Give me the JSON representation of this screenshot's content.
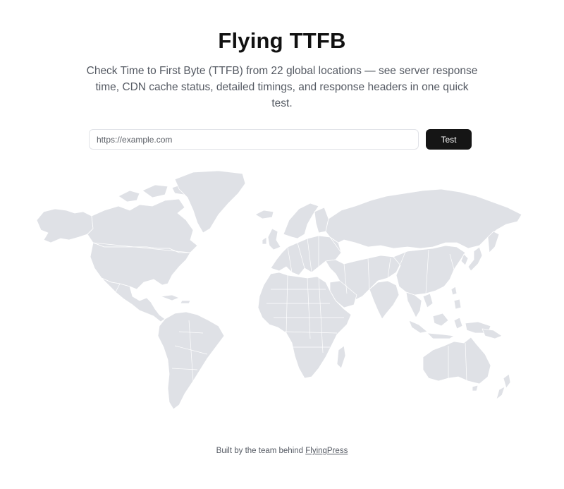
{
  "header": {
    "title": "Flying TTFB",
    "subtitle": "Check Time to First Byte (TTFB) from 22 global locations — see server response time, CDN cache status, detailed timings, and response headers in one quick test."
  },
  "search": {
    "placeholder": "https://example.com",
    "value": "",
    "button_label": "Test"
  },
  "map": {
    "icon": "world-map",
    "land_color": "#dfe1e6"
  },
  "footer": {
    "text": "Built by the team behind",
    "link_label": "FlyingPress"
  },
  "colors": {
    "button_bg": "#151515",
    "button_text": "#ffffff",
    "muted_text": "#555a63"
  }
}
